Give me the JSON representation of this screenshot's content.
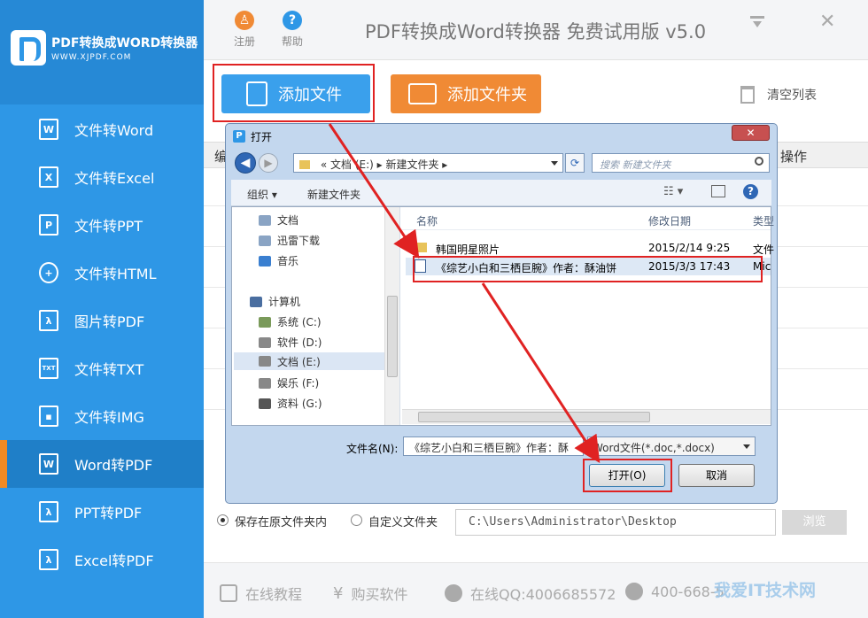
{
  "brand": {
    "title": "PDF转换成WORD转换器",
    "url": "WWW.XJPDF.COM"
  },
  "sidebar": {
    "items": [
      {
        "label": "文件转Word",
        "icon": "W"
      },
      {
        "label": "文件转Excel",
        "icon": "X"
      },
      {
        "label": "文件转PPT",
        "icon": "P"
      },
      {
        "label": "文件转HTML",
        "icon": "globe"
      },
      {
        "label": "图片转PDF",
        "icon": "pdf"
      },
      {
        "label": "文件转TXT",
        "icon": "TXT"
      },
      {
        "label": "文件转IMG",
        "icon": "img"
      },
      {
        "label": "Word转PDF",
        "icon": "W",
        "active": true
      },
      {
        "label": "PPT转PDF",
        "icon": "pdf"
      },
      {
        "label": "Excel转PDF",
        "icon": "pdf"
      }
    ]
  },
  "topbar": {
    "register": "注册",
    "help": "帮助",
    "title": "PDF转换成Word转换器 免费试用版 v5.0"
  },
  "actions": {
    "add_file": "添加文件",
    "add_folder": "添加文件夹",
    "clear_list": "清空列表"
  },
  "table": {
    "col_no": "编",
    "col_action": "操作"
  },
  "output": {
    "save_original": "保存在原文件夹内",
    "custom_folder": "自定义文件夹",
    "path": "C:\\Users\\Administrator\\Desktop",
    "browse": "浏览"
  },
  "footer": {
    "tutorial": "在线教程",
    "buy": "购买软件",
    "qq": "在线QQ:4006685572",
    "phone": "400-668-5"
  },
  "watermark": "我爱IT技术网",
  "dialog": {
    "title": "打开",
    "address": "«  文档 (E:)  ▸  新建文件夹  ▸",
    "search_placeholder": "搜索 新建文件夹",
    "organize": "组织 ▾",
    "new_folder": "新建文件夹",
    "tree": [
      "文档",
      "迅雷下载",
      "音乐",
      "计算机",
      "系统 (C:)",
      "软件 (D:)",
      "文档 (E:)",
      "娱乐 (F:)",
      "资料 (G:)"
    ],
    "columns": {
      "name": "名称",
      "date": "修改日期",
      "type": "类型"
    },
    "files": [
      {
        "name": "韩国明星照片",
        "date": "2015/2/14 9:25",
        "type": "文件",
        "kind": "folder"
      },
      {
        "name": "《综艺小白和三栖巨腕》作者：酥油饼",
        "date": "2015/3/3 17:43",
        "type": "Mic",
        "kind": "doc"
      }
    ],
    "filename_label": "文件名(N):",
    "filename": "《综艺小白和三栖巨腕》作者：酥",
    "filetype": "Word文件(*.doc,*.docx)",
    "open": "打开(O)",
    "cancel": "取消"
  },
  "colors": {
    "sidebar": "#2e97e6",
    "accent_orange": "#f08a35",
    "highlight_red": "#e02222"
  }
}
